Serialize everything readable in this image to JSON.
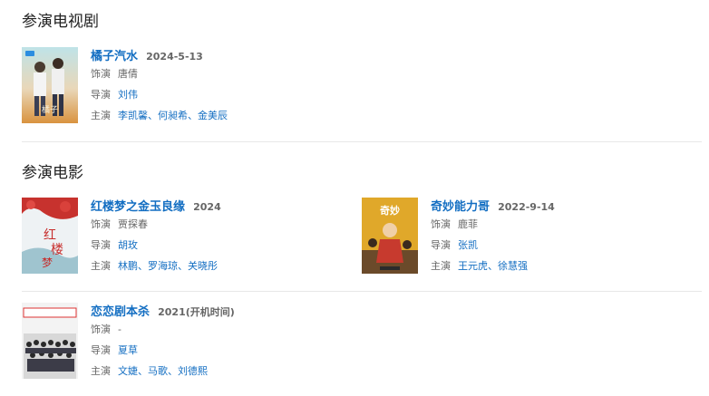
{
  "tv_section": {
    "title": "参演电视剧",
    "items": [
      {
        "title": "橘子汽水",
        "date": "2024-5-13",
        "role_label": "饰演",
        "role": "唐倩",
        "director_label": "导演",
        "directors": [
          "刘伟"
        ],
        "cast_label": "主演",
        "cast": [
          "李凯馨",
          "何昶希",
          "金美辰"
        ]
      }
    ]
  },
  "movie_section": {
    "title": "参演电影",
    "items": [
      {
        "title": "红楼梦之金玉良缘",
        "date": "2024",
        "role_label": "饰演",
        "role": "贾探春",
        "director_label": "导演",
        "directors": [
          "胡玫"
        ],
        "cast_label": "主演",
        "cast": [
          "林鹏",
          "罗海琼",
          "关晓彤"
        ]
      },
      {
        "title": "奇妙能力哥",
        "date": "2022-9-14",
        "role_label": "饰演",
        "role": "鹿菲",
        "director_label": "导演",
        "directors": [
          "张凯"
        ],
        "cast_label": "主演",
        "cast": [
          "王元虎",
          "徐慧强"
        ]
      },
      {
        "title": "恋恋剧本杀",
        "date": "2021(开机时间)",
        "role_label": "饰演",
        "role": "-",
        "director_label": "导演",
        "directors": [
          "夏草"
        ],
        "cast_label": "主演",
        "cast": [
          "文婕",
          "马歌",
          "刘德熙"
        ]
      }
    ]
  },
  "separator": "、",
  "colors": {
    "link": "#136ec2",
    "muted": "#666666",
    "divider": "#e8e8e8"
  }
}
